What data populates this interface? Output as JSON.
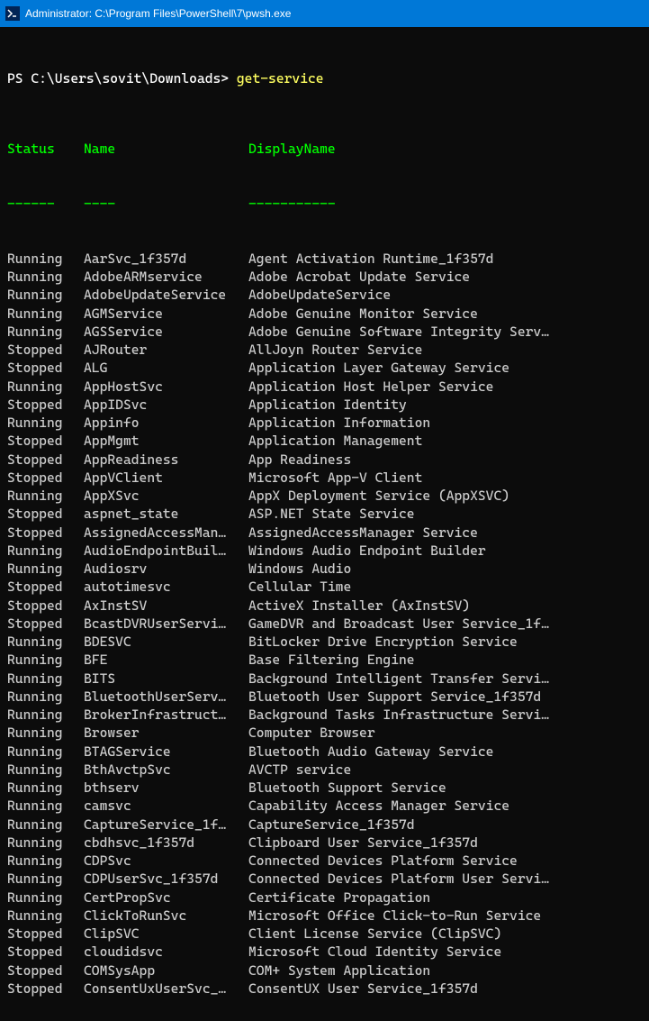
{
  "window": {
    "title": "Administrator: C:\\Program Files\\PowerShell\\7\\pwsh.exe"
  },
  "prompt": {
    "path": "PS C:\\Users\\sovit\\Downloads> ",
    "command": "get-service"
  },
  "headers": {
    "status": "Status",
    "name": "Name",
    "displayName": "DisplayName"
  },
  "dashes": {
    "status": "------",
    "name": "----",
    "displayName": "-----------"
  },
  "services": [
    {
      "status": "Running",
      "name": "AarSvc_1f357d",
      "displayName": "Agent Activation Runtime_1f357d"
    },
    {
      "status": "Running",
      "name": "AdobeARMservice",
      "displayName": "Adobe Acrobat Update Service"
    },
    {
      "status": "Running",
      "name": "AdobeUpdateService",
      "displayName": "AdobeUpdateService"
    },
    {
      "status": "Running",
      "name": "AGMService",
      "displayName": "Adobe Genuine Monitor Service"
    },
    {
      "status": "Running",
      "name": "AGSService",
      "displayName": "Adobe Genuine Software Integrity Serv…"
    },
    {
      "status": "Stopped",
      "name": "AJRouter",
      "displayName": "AllJoyn Router Service"
    },
    {
      "status": "Stopped",
      "name": "ALG",
      "displayName": "Application Layer Gateway Service"
    },
    {
      "status": "Running",
      "name": "AppHostSvc",
      "displayName": "Application Host Helper Service"
    },
    {
      "status": "Stopped",
      "name": "AppIDSvc",
      "displayName": "Application Identity"
    },
    {
      "status": "Running",
      "name": "Appinfo",
      "displayName": "Application Information"
    },
    {
      "status": "Stopped",
      "name": "AppMgmt",
      "displayName": "Application Management"
    },
    {
      "status": "Stopped",
      "name": "AppReadiness",
      "displayName": "App Readiness"
    },
    {
      "status": "Stopped",
      "name": "AppVClient",
      "displayName": "Microsoft App-V Client"
    },
    {
      "status": "Running",
      "name": "AppXSvc",
      "displayName": "AppX Deployment Service (AppXSVC)"
    },
    {
      "status": "Stopped",
      "name": "aspnet_state",
      "displayName": "ASP.NET State Service"
    },
    {
      "status": "Stopped",
      "name": "AssignedAccessMan…",
      "displayName": "AssignedAccessManager Service"
    },
    {
      "status": "Running",
      "name": "AudioEndpointBuil…",
      "displayName": "Windows Audio Endpoint Builder"
    },
    {
      "status": "Running",
      "name": "Audiosrv",
      "displayName": "Windows Audio"
    },
    {
      "status": "Stopped",
      "name": "autotimesvc",
      "displayName": "Cellular Time"
    },
    {
      "status": "Stopped",
      "name": "AxInstSV",
      "displayName": "ActiveX Installer (AxInstSV)"
    },
    {
      "status": "Stopped",
      "name": "BcastDVRUserServi…",
      "displayName": "GameDVR and Broadcast User Service_1f…"
    },
    {
      "status": "Running",
      "name": "BDESVC",
      "displayName": "BitLocker Drive Encryption Service"
    },
    {
      "status": "Running",
      "name": "BFE",
      "displayName": "Base Filtering Engine"
    },
    {
      "status": "Running",
      "name": "BITS",
      "displayName": "Background Intelligent Transfer Servi…"
    },
    {
      "status": "Running",
      "name": "BluetoothUserServ…",
      "displayName": "Bluetooth User Support Service_1f357d"
    },
    {
      "status": "Running",
      "name": "BrokerInfrastruct…",
      "displayName": "Background Tasks Infrastructure Servi…"
    },
    {
      "status": "Running",
      "name": "Browser",
      "displayName": "Computer Browser"
    },
    {
      "status": "Running",
      "name": "BTAGService",
      "displayName": "Bluetooth Audio Gateway Service"
    },
    {
      "status": "Running",
      "name": "BthAvctpSvc",
      "displayName": "AVCTP service"
    },
    {
      "status": "Running",
      "name": "bthserv",
      "displayName": "Bluetooth Support Service"
    },
    {
      "status": "Running",
      "name": "camsvc",
      "displayName": "Capability Access Manager Service"
    },
    {
      "status": "Running",
      "name": "CaptureService_1f…",
      "displayName": "CaptureService_1f357d"
    },
    {
      "status": "Running",
      "name": "cbdhsvc_1f357d",
      "displayName": "Clipboard User Service_1f357d"
    },
    {
      "status": "Running",
      "name": "CDPSvc",
      "displayName": "Connected Devices Platform Service"
    },
    {
      "status": "Running",
      "name": "CDPUserSvc_1f357d",
      "displayName": "Connected Devices Platform User Servi…"
    },
    {
      "status": "Running",
      "name": "CertPropSvc",
      "displayName": "Certificate Propagation"
    },
    {
      "status": "Running",
      "name": "ClickToRunSvc",
      "displayName": "Microsoft Office Click-to-Run Service"
    },
    {
      "status": "Stopped",
      "name": "ClipSVC",
      "displayName": "Client License Service (ClipSVC)"
    },
    {
      "status": "Stopped",
      "name": "cloudidsvc",
      "displayName": "Microsoft Cloud Identity Service"
    },
    {
      "status": "Stopped",
      "name": "COMSysApp",
      "displayName": "COM+ System Application"
    },
    {
      "status": "Stopped",
      "name": "ConsentUxUserSvc_…",
      "displayName": "ConsentUX User Service_1f357d"
    }
  ]
}
